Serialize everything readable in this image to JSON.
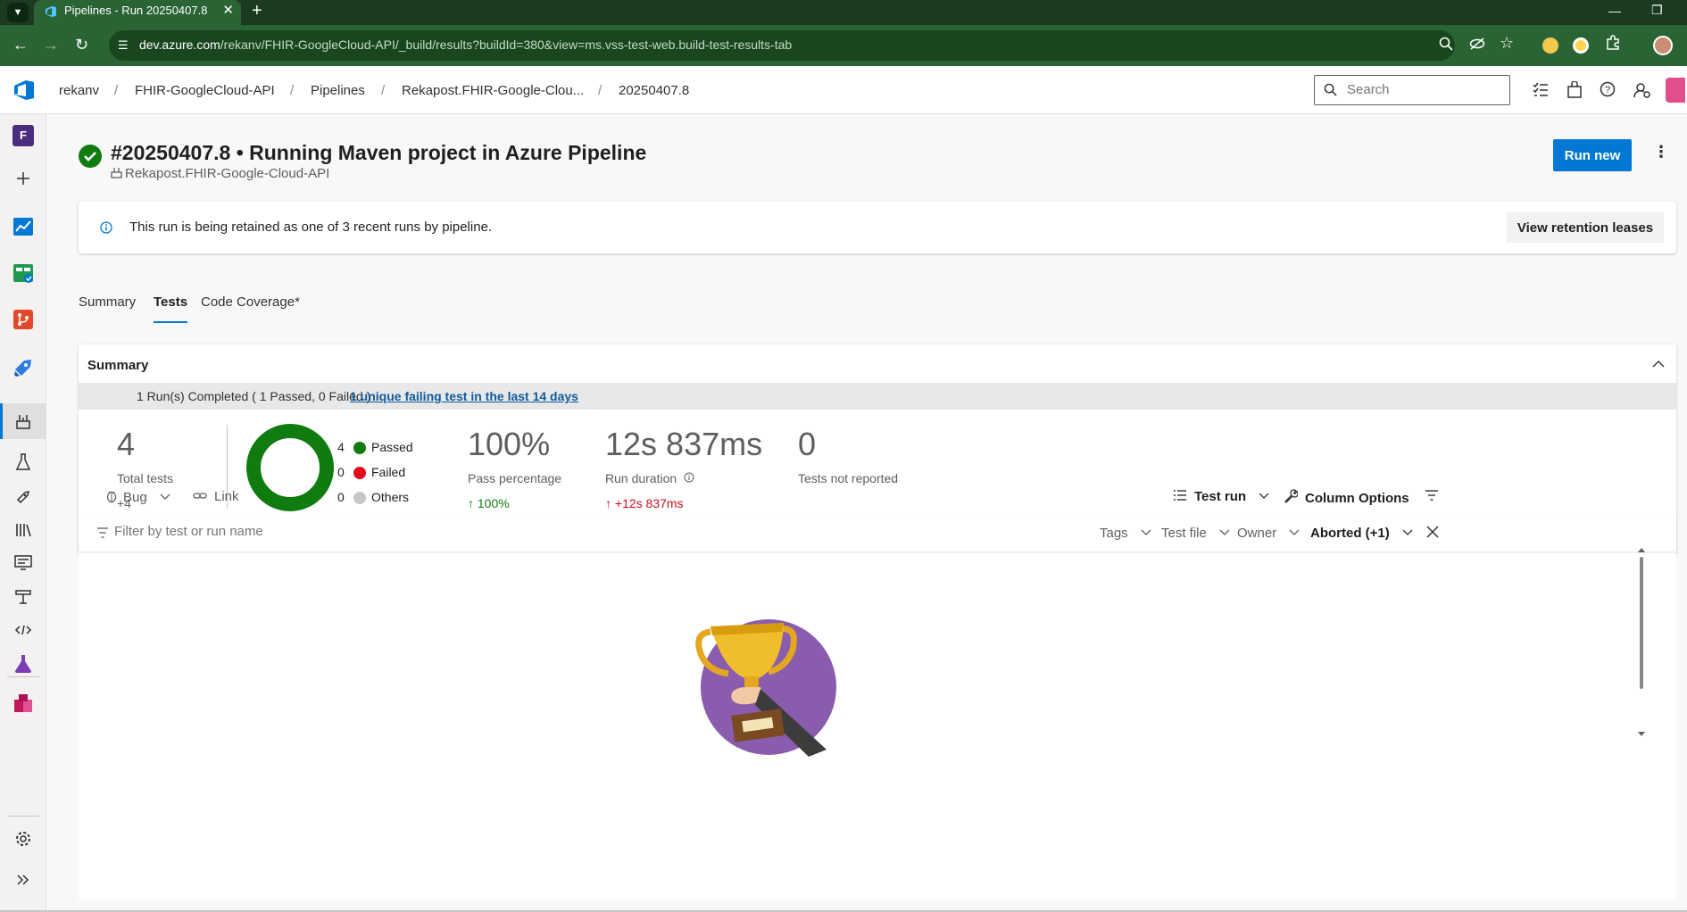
{
  "browser": {
    "tab_title": "Pipelines - Run 20250407.8",
    "close_glyph": "✕",
    "new_tab_glyph": "+",
    "url_host": "dev.azure.com",
    "url_path": "/rekanv/FHIR-GoogleCloud-API/_build/results?buildId=380&view=ms.vss-test-web.build-test-results-tab"
  },
  "breadcrumb": {
    "org": "rekanv",
    "project": "FHIR-GoogleCloud-API",
    "section": "Pipelines",
    "pipeline": "Rekapost.FHIR-Google-Clou...",
    "run": "20250407.8",
    "separator": "/"
  },
  "header": {
    "search_placeholder": "Search"
  },
  "rail": {
    "project_initial": "F"
  },
  "run": {
    "title": "#20250407.8 • Running Maven project in Azure Pipeline",
    "pipeline_name": "Rekapost.FHIR-Google-Cloud-API",
    "run_new_label": "Run new",
    "more_glyph": "⋮"
  },
  "banner": {
    "message": "This run is being retained as one of 3 recent runs by pipeline.",
    "button_label": "View retention leases"
  },
  "tabs": [
    {
      "label": "Summary",
      "selected": false
    },
    {
      "label": "Tests",
      "selected": true
    },
    {
      "label": "Code Coverage*",
      "selected": false
    }
  ],
  "summary": {
    "heading": "Summary",
    "runs_completed": "1 Run(s) Completed ( 1 Passed, 0 Failed )",
    "failing_link": "1 unique failing test in the last 14 days",
    "total_tests": "4",
    "total_tests_label": "Total tests",
    "total_tests_delta": "+4",
    "donut": {
      "passed": 4,
      "failed": 0,
      "others": 0
    },
    "legend": [
      {
        "count": "4",
        "label": "Passed",
        "color": "#107c10"
      },
      {
        "count": "0",
        "label": "Failed",
        "color": "#e00b1c"
      },
      {
        "count": "0",
        "label": "Others",
        "color": "#c8c6c4"
      }
    ],
    "pass_percentage": "100%",
    "pass_percentage_label": "Pass percentage",
    "pass_percentage_delta": "↑  100%",
    "run_duration": "12s 837ms",
    "run_duration_label": "Run duration",
    "run_duration_delta": "↑  +12s 837ms",
    "not_reported": "0",
    "not_reported_label": "Tests not reported"
  },
  "toolbar": {
    "bug_label": "Bug",
    "link_label": "Link",
    "test_run_label": "Test run",
    "column_options_label": "Column Options"
  },
  "filter": {
    "placeholder": "Filter by test or run name",
    "tags": "Tags",
    "test_file": "Test file",
    "owner": "Owner",
    "outcome": "Aborted (+1)"
  },
  "colors": {
    "accent": "#0078d4",
    "passed": "#107c10",
    "failed": "#e00b1c",
    "browser_green": "#2a6334"
  }
}
